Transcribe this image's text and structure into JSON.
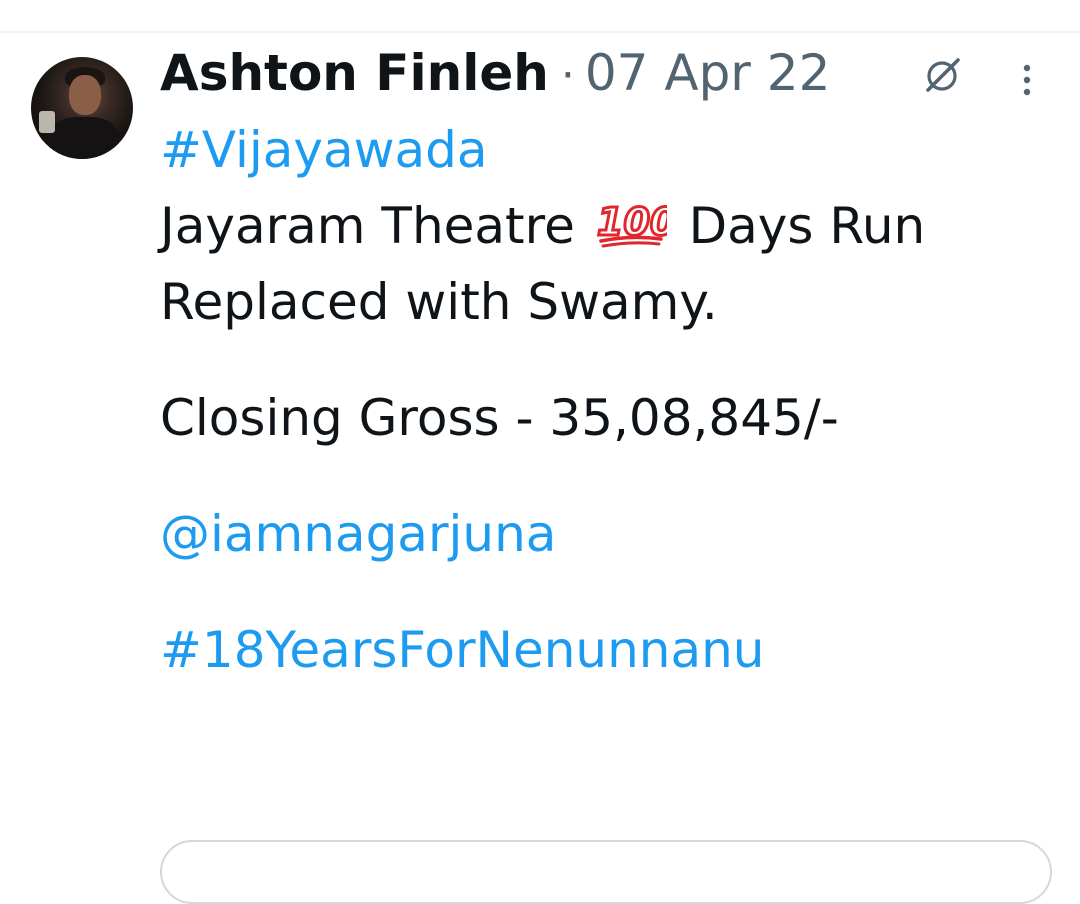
{
  "tweet": {
    "display_name": "Ashton Finleh",
    "separator": "·",
    "date": "07 Apr 22",
    "lines": {
      "hashtag_city": "#Vijayawada",
      "line1_before_emoji": "Jayaram Theatre",
      "emoji_label": "100 emoji",
      "line1_after_emoji": "Days Run",
      "line2": "Replaced with Swamy.",
      "line3": "Closing Gross - 35,08,845/-",
      "mention": "@iamnagarjuna",
      "hashtag_anniversary": "#18YearsForNenunnanu"
    }
  },
  "icons": {
    "grok": "grok-slash-circle-icon",
    "more": "more-vertical-icon",
    "hundred": "hundred-points-emoji"
  },
  "colors": {
    "link": "#1d9bf0",
    "text": "#0f1419",
    "muted": "#536471",
    "emoji_red": "#e1262d"
  }
}
